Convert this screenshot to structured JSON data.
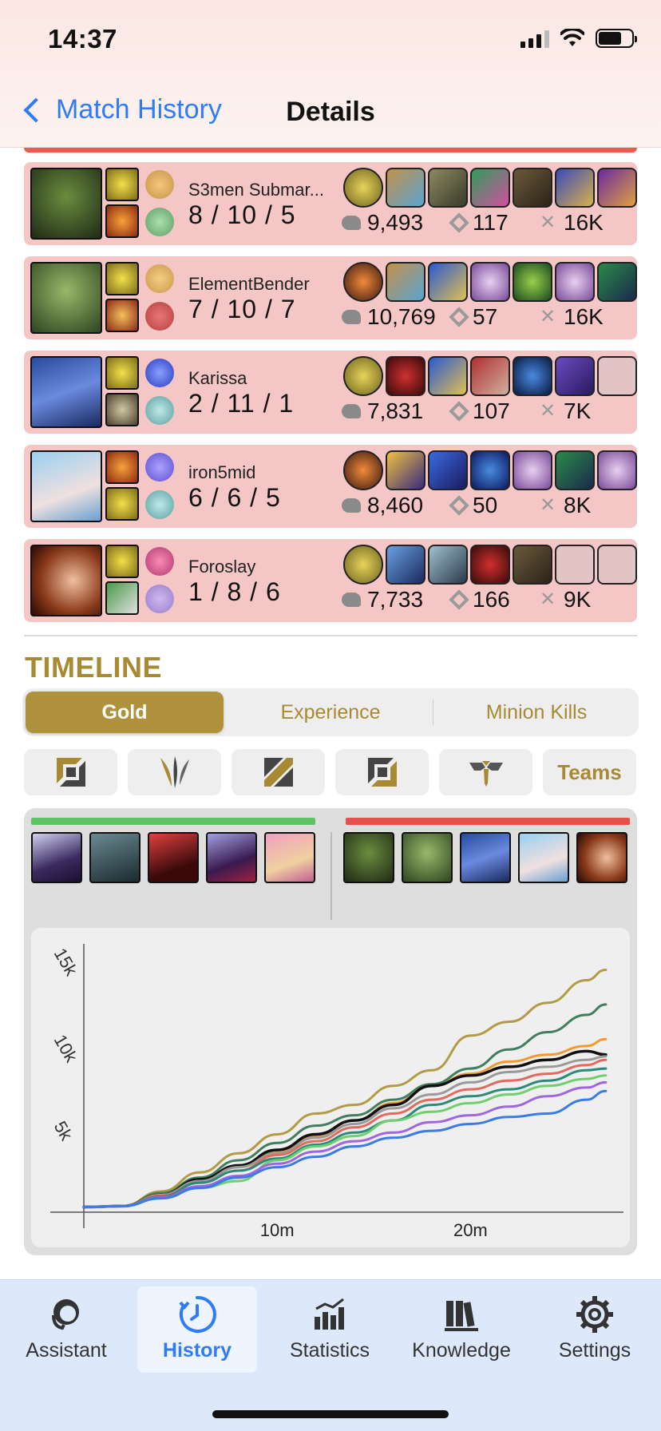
{
  "status_bar": {
    "time": "14:37"
  },
  "nav": {
    "back_label": "Match History",
    "title": "Details"
  },
  "players": [
    {
      "name": "S3men Submar...",
      "kda": "8 / 10 / 5",
      "gold": "9,493",
      "cs": "117",
      "damage": "16K",
      "empty_slots": 0
    },
    {
      "name": "ElementBender",
      "kda": "7 / 10 / 7",
      "gold": "10,769",
      "cs": "57",
      "damage": "16K",
      "empty_slots": 0
    },
    {
      "name": "Karissa",
      "kda": "2 / 11 / 1",
      "gold": "7,831",
      "cs": "107",
      "damage": "7K",
      "empty_slots": 1
    },
    {
      "name": "iron5mid",
      "kda": "6 / 6 / 5",
      "gold": "8,460",
      "cs": "50",
      "damage": "8K",
      "empty_slots": 0
    },
    {
      "name": "Foroslay",
      "kda": "1 / 8 / 6",
      "gold": "7,733",
      "cs": "166",
      "damage": "9K",
      "empty_slots": 2
    }
  ],
  "timeline": {
    "title": "TIMELINE",
    "tabs": [
      "Gold",
      "Experience",
      "Minion Kills"
    ],
    "active_tab": "Gold",
    "role_filters": [
      "top-icon",
      "jungle-icon",
      "mid-icon",
      "bot-icon",
      "support-icon"
    ],
    "teams_label": "Teams"
  },
  "team_colors": {
    "blue": "#5cc561",
    "red": "#e8504a"
  },
  "chart_data": {
    "type": "line",
    "x": [
      0,
      2,
      4,
      6,
      8,
      10,
      12,
      14,
      16,
      18,
      20,
      22,
      24,
      26,
      27
    ],
    "xticks": [
      "10m",
      "20m"
    ],
    "xtick_values": [
      10,
      20
    ],
    "yticks": [
      "5k",
      "10k",
      "15k"
    ],
    "ytick_values": [
      5000,
      10000,
      15000
    ],
    "ylim": [
      0,
      15500
    ],
    "xlim": [
      0,
      27.5
    ],
    "series": [
      {
        "color": "#b39a44",
        "values": [
          300,
          350,
          1200,
          2300,
          3400,
          4500,
          5700,
          6200,
          7300,
          8200,
          10200,
          11000,
          12100,
          13400,
          14000
        ]
      },
      {
        "color": "#3f7f5f",
        "values": [
          300,
          350,
          1100,
          2000,
          3000,
          4000,
          5000,
          5600,
          6500,
          7400,
          8300,
          9400,
          10400,
          11400,
          12000
        ]
      },
      {
        "color": "#f29a2e",
        "values": [
          300,
          350,
          950,
          1800,
          2600,
          3500,
          4400,
          5300,
          6300,
          7300,
          8000,
          8700,
          9100,
          9600,
          10000
        ]
      },
      {
        "color": "#111111",
        "values": [
          300,
          350,
          1000,
          1900,
          2700,
          3600,
          4500,
          5300,
          6200,
          7300,
          7900,
          8400,
          8800,
          9300,
          9100
        ]
      },
      {
        "color": "#9a9a9a",
        "values": [
          300,
          350,
          1000,
          1800,
          2600,
          3400,
          4300,
          5100,
          6000,
          6800,
          7500,
          8100,
          8400,
          8800,
          9000
        ]
      },
      {
        "color": "#e36a5c",
        "values": [
          300,
          350,
          950,
          1700,
          2400,
          3300,
          4100,
          4900,
          5700,
          6500,
          7100,
          7600,
          8000,
          8500,
          8800
        ]
      },
      {
        "color": "#2c8a7a",
        "values": [
          300,
          350,
          900,
          1700,
          2400,
          3100,
          3900,
          4600,
          5300,
          6200,
          6700,
          7100,
          7600,
          8200,
          8300
        ]
      },
      {
        "color": "#6fcf6f",
        "values": [
          300,
          350,
          850,
          1400,
          1800,
          3000,
          3800,
          4400,
          5300,
          5800,
          6300,
          6800,
          7300,
          7700,
          7900
        ]
      },
      {
        "color": "#a065e0",
        "values": [
          300,
          350,
          850,
          1500,
          2100,
          2800,
          3500,
          4100,
          4600,
          5200,
          5600,
          6100,
          6700,
          7200,
          7500
        ]
      },
      {
        "color": "#3a7be8",
        "values": [
          300,
          350,
          800,
          1400,
          2000,
          2600,
          3200,
          3800,
          4300,
          4700,
          5100,
          5500,
          5700,
          6500,
          7000
        ]
      }
    ]
  },
  "tab_bar": {
    "items": [
      {
        "label": "Assistant",
        "icon": "assistant-icon"
      },
      {
        "label": "History",
        "icon": "history-icon"
      },
      {
        "label": "Statistics",
        "icon": "statistics-icon"
      },
      {
        "label": "Knowledge",
        "icon": "knowledge-icon"
      },
      {
        "label": "Settings",
        "icon": "settings-icon"
      }
    ],
    "active": "History"
  }
}
